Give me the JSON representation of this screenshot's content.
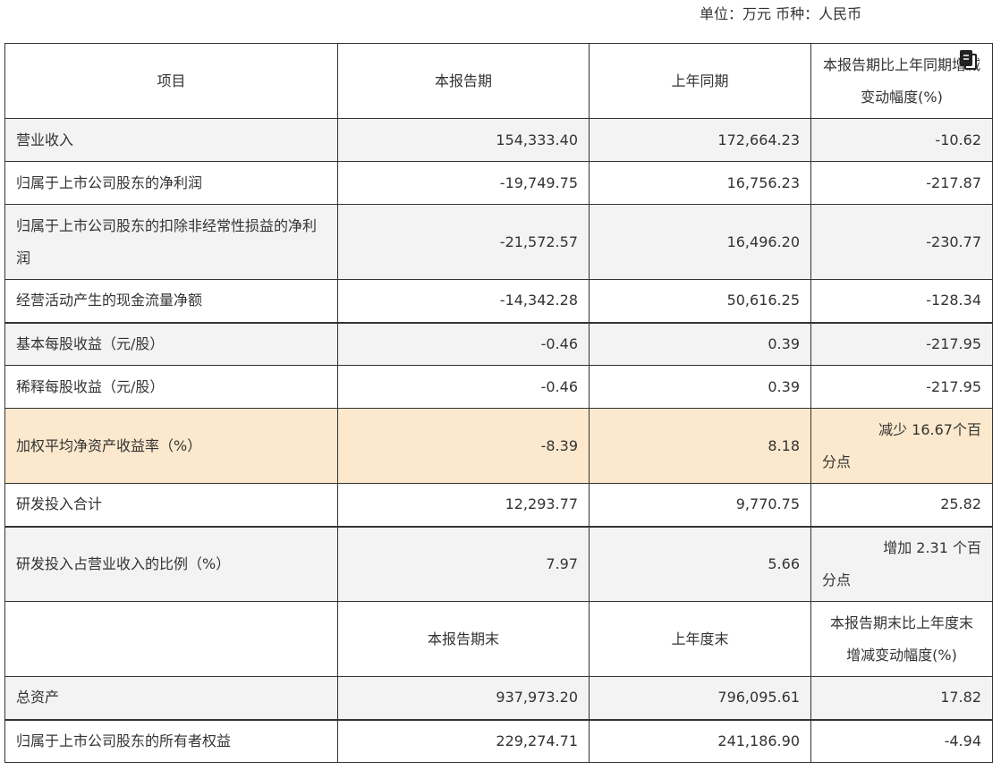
{
  "unit_line": "单位：万元 币种：人民币",
  "header": {
    "col0": "项目",
    "col1": "本报告期",
    "col2": "上年同期",
    "col3": "本报告期比上年同期增减变动幅度(%)"
  },
  "rows": [
    {
      "label": "营业收入",
      "current": "154,333.40",
      "prior": "172,664.23",
      "change": "-10.62"
    },
    {
      "label": "归属于上市公司股东的净利润",
      "current": "-19,749.75",
      "prior": "16,756.23",
      "change": "-217.87"
    },
    {
      "label": "归属于上市公司股东的扣除非经常性损益的净利润",
      "current": "-21,572.57",
      "prior": "16,496.20",
      "change": "-230.77"
    },
    {
      "label": "经营活动产生的现金流量净额",
      "current": "-14,342.28",
      "prior": "50,616.25",
      "change": "-128.34"
    },
    {
      "label": "基本每股收益（元/股）",
      "current": "-0.46",
      "prior": "0.39",
      "change": "-217.95"
    },
    {
      "label": "稀释每股收益（元/股）",
      "current": "-0.46",
      "prior": "0.39",
      "change": "-217.95"
    },
    {
      "label": "加权平均净资产收益率（%）",
      "current": "-8.39",
      "prior": "8.18",
      "change_l1": "减少 16.67个百",
      "change_l2": "分点"
    },
    {
      "label": "研发投入合计",
      "current": "12,293.77",
      "prior": "9,770.75",
      "change": "25.82"
    },
    {
      "label": "研发投入占营业收入的比例（%）",
      "current": "7.97",
      "prior": "5.66",
      "change_l1": "增加 2.31 个百",
      "change_l2": "分点"
    }
  ],
  "header2": {
    "col0": "",
    "col1": "本报告期末",
    "col2": "上年度末",
    "col3_l1": "本报告期末比上年度末",
    "col3_l2": "增减变动幅度(%)"
  },
  "rows2": [
    {
      "label": "总资产",
      "current": "937,973.20",
      "prior": "796,095.61",
      "change": "17.82"
    },
    {
      "label": "归属于上市公司股东的所有者权益",
      "current": "229,274.71",
      "prior": "241,186.90",
      "change": "-4.94"
    }
  ]
}
